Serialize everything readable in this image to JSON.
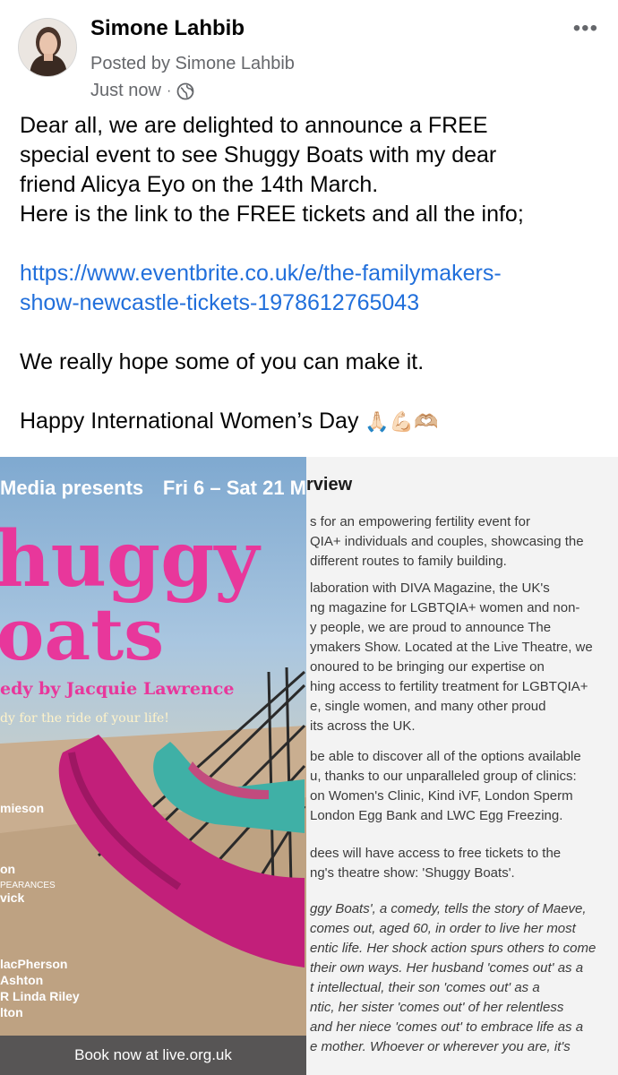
{
  "post": {
    "author": "Simone Lahbib",
    "posted_by": "Posted by Simone Lahbib",
    "time": "Just now",
    "separator": "·",
    "privacy_icon": "globe-icon",
    "more_label": "•••",
    "lines": [
      "Dear all, we are delighted to announce a FREE",
      "special event to see Shuggy Boats with my dear",
      "friend Alicya Eyo on the 14th March.",
      "Here is the link to the FREE tickets and all the info;"
    ],
    "link_line1": "https://www.eventbrite.co.uk/e/the-familymakers-",
    "link_line2": "show-newcastle-tickets-1978612765043",
    "closing": "We really hope some of you can make it.",
    "greeting": "Happy International Women’s Day",
    "greeting_emoji": "🙏🏻💪🏻🫶🏼"
  },
  "poster": {
    "presents": "Media presents",
    "dates": "Fri 6 – Sat 21 M",
    "title_line1": "huggy",
    "title_line2": "oats",
    "subtitle": "edy by Jacquie Lawrence",
    "tagline": "dy for the ride of your life!",
    "cast": [
      "mieson",
      "on",
      "PEARANCES",
      "vick",
      "lacPherson",
      "Ashton",
      "R Linda Riley",
      "lton"
    ],
    "book_label": "Book now at live.org.uk",
    "colors": {
      "title": "#e8379b",
      "footer": "#575555"
    }
  },
  "article": {
    "heading": "rview",
    "paragraphs": [
      [
        "s for an empowering fertility event for",
        "QIA+ individuals and couples, showcasing the",
        "different routes to family building."
      ],
      [
        "laboration with DIVA Magazine, the UK's",
        "ng magazine for LGBTQIA+ women and non-",
        "y people, we are proud to announce The",
        "ymakers Show. Located at the Live Theatre, we",
        "onoured to be bringing our expertise on",
        "hing access to fertility treatment for LGBTQIA+",
        "e, single women, and many other proud",
        "its across the UK."
      ],
      [
        "be able to discover all of the options available",
        "u, thanks to our unparalleled group of clinics:",
        "on Women's Clinic, Kind iVF, London Sperm",
        "London Egg Bank and LWC Egg Freezing."
      ],
      [
        "dees will have access to free tickets to the",
        "ng's theatre show: 'Shuggy Boats'."
      ],
      [
        "ggy Boats', a comedy, tells the story of Maeve,",
        "comes out, aged 60, in order to live her most",
        "entic life. Her shock action spurs others to come",
        "their own ways. Her husband 'comes out' as a",
        "t intellectual, their son 'comes out' as a",
        "ntic, her sister 'comes out' of her relentless",
        "and her niece 'comes out' to embrace life as a",
        "e mother. Whoever or wherever you are, it's"
      ]
    ]
  }
}
